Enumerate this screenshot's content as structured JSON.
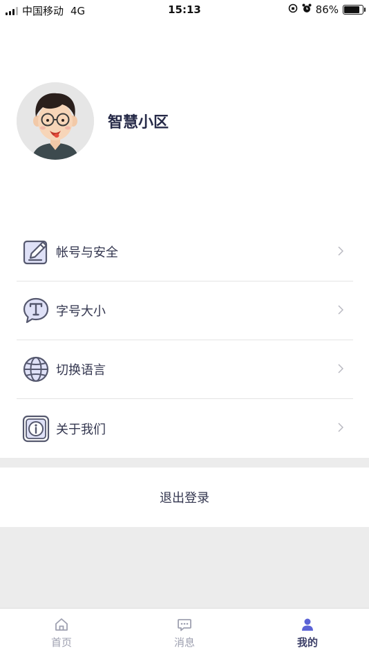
{
  "status_bar": {
    "carrier": "中国移动",
    "network": "4G",
    "time": "15:13",
    "battery_text": "86%",
    "battery_level": 0.86
  },
  "profile": {
    "name": "智慧小区",
    "avatar_icon": "cartoon-avatar"
  },
  "menu": {
    "items": [
      {
        "label": "帐号与安全",
        "icon": "edit-icon"
      },
      {
        "label": "字号大小",
        "icon": "font-size-icon"
      },
      {
        "label": "切换语言",
        "icon": "globe-icon"
      },
      {
        "label": "关于我们",
        "icon": "info-icon"
      }
    ]
  },
  "logout": {
    "label": "退出登录"
  },
  "tab_bar": {
    "tabs": [
      {
        "label": "首页",
        "icon": "home-icon",
        "active": false
      },
      {
        "label": "消息",
        "icon": "message-icon",
        "active": false
      },
      {
        "label": "我的",
        "icon": "user-icon",
        "active": true
      }
    ]
  },
  "colors": {
    "accent": "#5b63d6",
    "text_primary": "#262a48",
    "tab_inactive": "#9ea0b0",
    "divider_gray": "#ececec"
  }
}
